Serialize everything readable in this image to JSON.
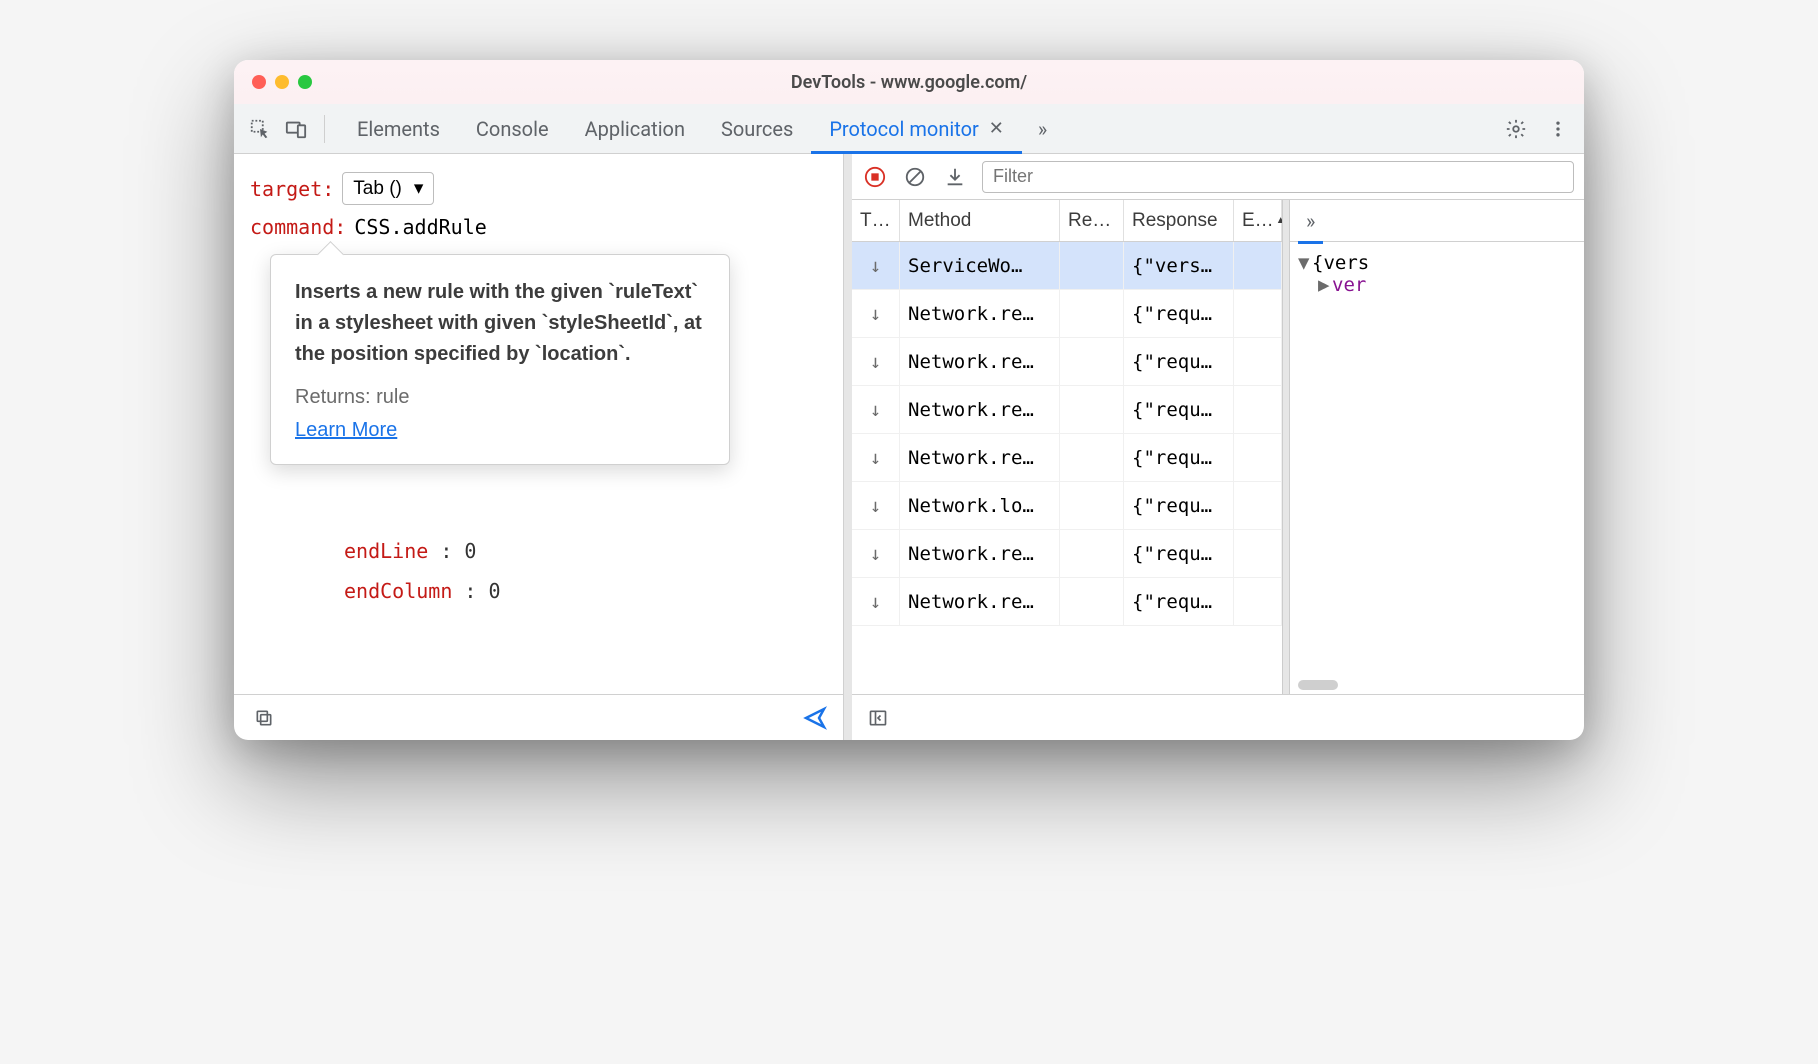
{
  "window": {
    "title": "DevTools - www.google.com/"
  },
  "toolbar": {
    "tabs": [
      "Elements",
      "Console",
      "Application",
      "Sources",
      "Protocol monitor"
    ],
    "active_tab_index": 4
  },
  "editor": {
    "target_label": "target",
    "target_value": "Tab ()",
    "command_label": "command",
    "command_value": "CSS.addRule",
    "popup": {
      "description": "Inserts a new rule with the given `ruleText` in a stylesheet with given `styleSheetId`, at the position specified by `location`.",
      "returns": "Returns: rule",
      "learn_more": "Learn More"
    },
    "params": [
      {
        "key": "endLine",
        "value": "0"
      },
      {
        "key": "endColumn",
        "value": "0"
      }
    ]
  },
  "filterbar": {
    "placeholder": "Filter"
  },
  "table": {
    "headers": {
      "type": "T…",
      "method": "Method",
      "request": "Re…",
      "response": "Response",
      "e": "E…"
    },
    "rows": [
      {
        "method": "ServiceWo…",
        "response": "{\"vers…",
        "selected": true
      },
      {
        "method": "Network.re…",
        "response": "{\"requ…"
      },
      {
        "method": "Network.re…",
        "response": "{\"requ…"
      },
      {
        "method": "Network.re…",
        "response": "{\"requ…"
      },
      {
        "method": "Network.re…",
        "response": "{\"requ…"
      },
      {
        "method": "Network.lo…",
        "response": "{\"requ…"
      },
      {
        "method": "Network.re…",
        "response": "{\"requ…"
      },
      {
        "method": "Network.re…",
        "response": "{\"requ…"
      }
    ]
  },
  "detail": {
    "root": "{vers",
    "child_key": "ver"
  }
}
